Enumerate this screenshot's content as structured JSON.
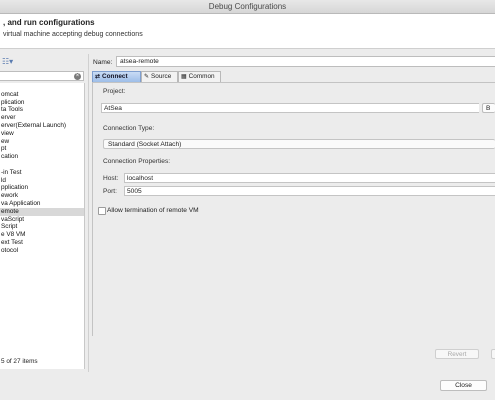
{
  "window": {
    "title": "Debug Configurations"
  },
  "header": {
    "title": ", and run configurations",
    "description": "virtual machine accepting debug connections"
  },
  "left": {
    "toolbar_icon": "new-configuration-icon",
    "filter_placeholder": "",
    "tree_items": [
      {
        "label": "",
        "selected": false
      },
      {
        "label": "omcat",
        "selected": false
      },
      {
        "label": "plication",
        "selected": false
      },
      {
        "label": "ta Tools",
        "selected": false
      },
      {
        "label": "erver",
        "selected": false
      },
      {
        "label": "erver(External Launch)",
        "selected": false
      },
      {
        "label": "view",
        "selected": false
      },
      {
        "label": "ew",
        "selected": false
      },
      {
        "label": "pt",
        "selected": false
      },
      {
        "label": "cation",
        "selected": false
      },
      {
        "label": "",
        "selected": false
      },
      {
        "label": "-in Test",
        "selected": false
      },
      {
        "label": "ld",
        "selected": false
      },
      {
        "label": "pplication",
        "selected": false
      },
      {
        "label": "ework",
        "selected": false
      },
      {
        "label": "va Application",
        "selected": false
      },
      {
        "label": "emote",
        "selected": true
      },
      {
        "label": "vaScript",
        "selected": false
      },
      {
        "label": "Script",
        "selected": false
      },
      {
        "label": "e V8 VM",
        "selected": false
      },
      {
        "label": "ext Test",
        "selected": false
      },
      {
        "label": "otocol",
        "selected": false
      }
    ],
    "status": "5 of 27 items"
  },
  "config": {
    "name_label": "Name:",
    "name_value": "atsea-remote",
    "tabs": [
      {
        "label": "Connect",
        "icon": "connect-icon",
        "active": true
      },
      {
        "label": "Source",
        "icon": "source-icon",
        "active": false
      },
      {
        "label": "Common",
        "icon": "common-icon",
        "active": false
      }
    ],
    "project_label": "Project:",
    "project_value": "AtSea",
    "browse_label": "B",
    "connection_type_label": "Connection Type:",
    "connection_type_value": "Standard (Socket Attach)",
    "connection_props_label": "Connection Properties:",
    "host_label": "Host:",
    "host_value": "localhost",
    "port_label": "Port:",
    "port_value": "5005",
    "allow_termination_label": "Allow termination of remote VM",
    "allow_termination_checked": false
  },
  "buttons": {
    "revert": "Revert",
    "close": "Close"
  }
}
